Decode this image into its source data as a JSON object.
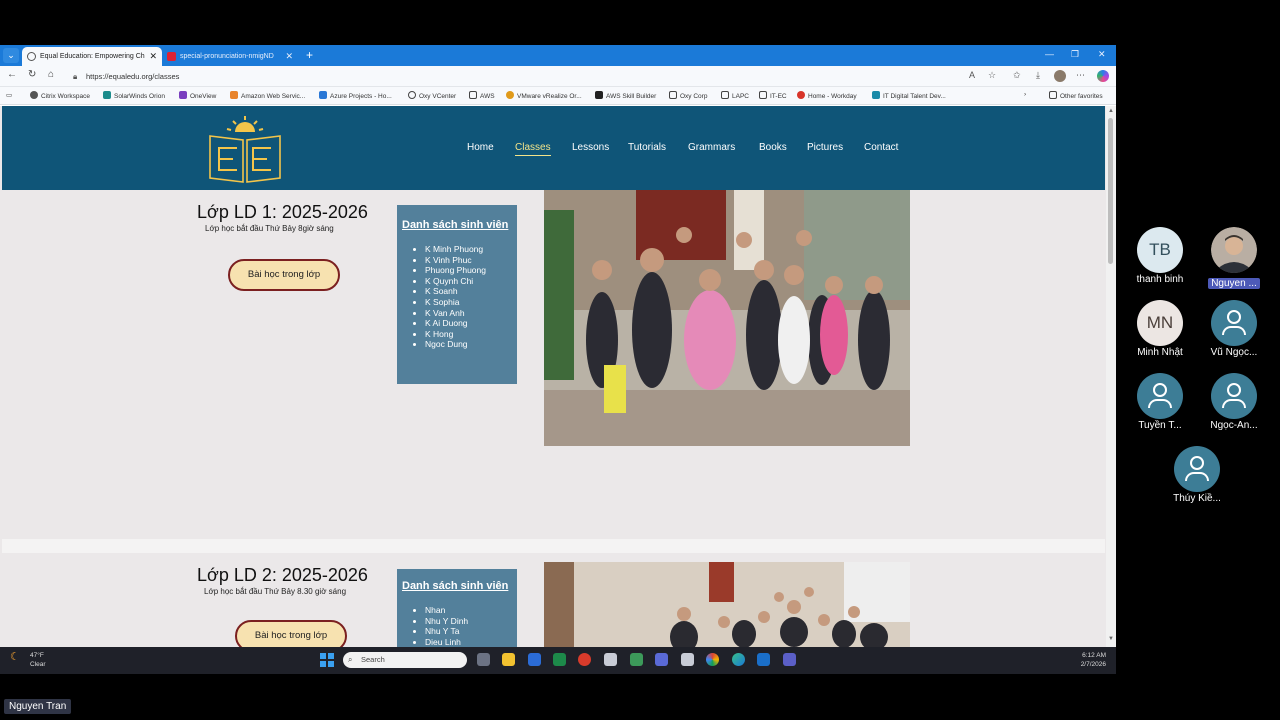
{
  "browser": {
    "tabs": [
      {
        "label": "Equal Education: Empowering Ch",
        "active": true
      },
      {
        "label": "special-pronunciation-nmigND"
      }
    ],
    "url": "https://equaledu.org/classes",
    "favorites": [
      "Citrix Workspace",
      "SolarWinds Orion",
      "OneView",
      "Amazon Web Servic...",
      "Azure Projects - Ho...",
      "Oxy VCenter",
      "AWS",
      "VMware vRealize Or...",
      "AWS Skill Builder",
      "Oxy Corp",
      "LAPC",
      "IT-EC",
      "Home - Workday",
      "IT Digital Talent Dev..."
    ],
    "other_favorites": "Other favorites"
  },
  "site": {
    "nav": [
      "Home",
      "Classes",
      "Lessons",
      "Tutorials",
      "Grammars",
      "Books",
      "Pictures",
      "Contact"
    ],
    "active_nav": "Classes",
    "classes": [
      {
        "title": "Lớp LD 1: 2025-2026",
        "subtitle": "Lớp học bắt đầu Thứ Bảy 8giờ sáng",
        "button": "Bài học trong lớp",
        "list_title": "Danh sách sinh viên",
        "students": [
          "K Minh Phuong",
          "K Vinh Phuc",
          "Phuong Phuong",
          "K Quynh Chi",
          "K Soanh",
          "K Sophia",
          "K Van Anh",
          "K Ai Duong",
          "K Hong",
          "Ngoc Dung"
        ]
      },
      {
        "title": "Lớp LD 2: 2025-2026",
        "subtitle": "Lớp học bắt đầu Thứ Bảy 8.30 giờ sáng",
        "button": "Bài học trong lớp",
        "list_title": "Danh sách sinh viên",
        "students": [
          "Nhan",
          "Nhu Y Dinh",
          "Nhu Y Ta",
          "Dieu Linh"
        ]
      }
    ]
  },
  "taskbar": {
    "weather_temp": "47°F",
    "weather_desc": "Clear",
    "search_placeholder": "Search",
    "time": "6:12 AM",
    "date": "2/7/2026"
  },
  "meeting": {
    "participants": [
      {
        "initials": "TB",
        "name": "thanh binh",
        "avatar_color": "#dce9ef"
      },
      {
        "initials": "",
        "name": "Nguyen ...",
        "avatar_color": "#9a8c80",
        "highlighted": true
      },
      {
        "initials": "MN",
        "name": "Minh Nhật",
        "avatar_color": "#ece6e3"
      },
      {
        "initials": "",
        "name": "Vũ Ngọc...",
        "avatar_color": "#3d7d96"
      },
      {
        "initials": "",
        "name": "Tuyền T...",
        "avatar_color": "#3d7d96"
      },
      {
        "initials": "",
        "name": "Ngọc-An...",
        "avatar_color": "#3d7d96"
      },
      {
        "initials": "",
        "name": "Thúy Kiề...",
        "avatar_color": "#3d7d96"
      }
    ],
    "presenter": "Nguyen Tran"
  }
}
